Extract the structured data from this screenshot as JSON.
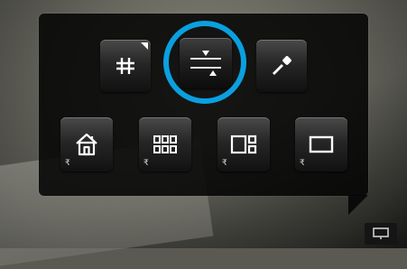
{
  "toolbar": {
    "top_row": [
      {
        "name": "grid",
        "icon": "grid-icon"
      },
      {
        "name": "adjust",
        "icon": "adjust-levels-icon",
        "selected": true
      },
      {
        "name": "eyedropper",
        "icon": "eyedropper-icon"
      }
    ],
    "bottom_row": [
      {
        "name": "home",
        "icon": "home-icon"
      },
      {
        "name": "multi-grid",
        "icon": "six-grid-icon"
      },
      {
        "name": "split",
        "icon": "split-view-icon"
      },
      {
        "name": "single",
        "icon": "single-view-icon"
      }
    ],
    "sub_mark": "₹"
  },
  "colors": {
    "highlight_ring": "#0aa0e0",
    "panel": "#050505"
  }
}
